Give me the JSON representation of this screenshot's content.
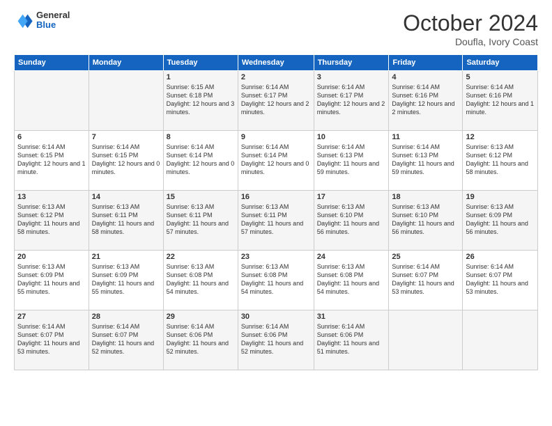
{
  "header": {
    "logo_general": "General",
    "logo_blue": "Blue",
    "month_title": "October 2024",
    "subtitle": "Doufla, Ivory Coast"
  },
  "weekdays": [
    "Sunday",
    "Monday",
    "Tuesday",
    "Wednesday",
    "Thursday",
    "Friday",
    "Saturday"
  ],
  "weeks": [
    [
      {
        "day": "",
        "info": ""
      },
      {
        "day": "",
        "info": ""
      },
      {
        "day": "1",
        "info": "Sunrise: 6:15 AM\nSunset: 6:18 PM\nDaylight: 12 hours and 3 minutes."
      },
      {
        "day": "2",
        "info": "Sunrise: 6:14 AM\nSunset: 6:17 PM\nDaylight: 12 hours and 2 minutes."
      },
      {
        "day": "3",
        "info": "Sunrise: 6:14 AM\nSunset: 6:17 PM\nDaylight: 12 hours and 2 minutes."
      },
      {
        "day": "4",
        "info": "Sunrise: 6:14 AM\nSunset: 6:16 PM\nDaylight: 12 hours and 2 minutes."
      },
      {
        "day": "5",
        "info": "Sunrise: 6:14 AM\nSunset: 6:16 PM\nDaylight: 12 hours and 1 minute."
      }
    ],
    [
      {
        "day": "6",
        "info": "Sunrise: 6:14 AM\nSunset: 6:15 PM\nDaylight: 12 hours and 1 minute."
      },
      {
        "day": "7",
        "info": "Sunrise: 6:14 AM\nSunset: 6:15 PM\nDaylight: 12 hours and 0 minutes."
      },
      {
        "day": "8",
        "info": "Sunrise: 6:14 AM\nSunset: 6:14 PM\nDaylight: 12 hours and 0 minutes."
      },
      {
        "day": "9",
        "info": "Sunrise: 6:14 AM\nSunset: 6:14 PM\nDaylight: 12 hours and 0 minutes."
      },
      {
        "day": "10",
        "info": "Sunrise: 6:14 AM\nSunset: 6:13 PM\nDaylight: 11 hours and 59 minutes."
      },
      {
        "day": "11",
        "info": "Sunrise: 6:14 AM\nSunset: 6:13 PM\nDaylight: 11 hours and 59 minutes."
      },
      {
        "day": "12",
        "info": "Sunrise: 6:13 AM\nSunset: 6:12 PM\nDaylight: 11 hours and 58 minutes."
      }
    ],
    [
      {
        "day": "13",
        "info": "Sunrise: 6:13 AM\nSunset: 6:12 PM\nDaylight: 11 hours and 58 minutes."
      },
      {
        "day": "14",
        "info": "Sunrise: 6:13 AM\nSunset: 6:11 PM\nDaylight: 11 hours and 58 minutes."
      },
      {
        "day": "15",
        "info": "Sunrise: 6:13 AM\nSunset: 6:11 PM\nDaylight: 11 hours and 57 minutes."
      },
      {
        "day": "16",
        "info": "Sunrise: 6:13 AM\nSunset: 6:11 PM\nDaylight: 11 hours and 57 minutes."
      },
      {
        "day": "17",
        "info": "Sunrise: 6:13 AM\nSunset: 6:10 PM\nDaylight: 11 hours and 56 minutes."
      },
      {
        "day": "18",
        "info": "Sunrise: 6:13 AM\nSunset: 6:10 PM\nDaylight: 11 hours and 56 minutes."
      },
      {
        "day": "19",
        "info": "Sunrise: 6:13 AM\nSunset: 6:09 PM\nDaylight: 11 hours and 56 minutes."
      }
    ],
    [
      {
        "day": "20",
        "info": "Sunrise: 6:13 AM\nSunset: 6:09 PM\nDaylight: 11 hours and 55 minutes."
      },
      {
        "day": "21",
        "info": "Sunrise: 6:13 AM\nSunset: 6:09 PM\nDaylight: 11 hours and 55 minutes."
      },
      {
        "day": "22",
        "info": "Sunrise: 6:13 AM\nSunset: 6:08 PM\nDaylight: 11 hours and 54 minutes."
      },
      {
        "day": "23",
        "info": "Sunrise: 6:13 AM\nSunset: 6:08 PM\nDaylight: 11 hours and 54 minutes."
      },
      {
        "day": "24",
        "info": "Sunrise: 6:13 AM\nSunset: 6:08 PM\nDaylight: 11 hours and 54 minutes."
      },
      {
        "day": "25",
        "info": "Sunrise: 6:14 AM\nSunset: 6:07 PM\nDaylight: 11 hours and 53 minutes."
      },
      {
        "day": "26",
        "info": "Sunrise: 6:14 AM\nSunset: 6:07 PM\nDaylight: 11 hours and 53 minutes."
      }
    ],
    [
      {
        "day": "27",
        "info": "Sunrise: 6:14 AM\nSunset: 6:07 PM\nDaylight: 11 hours and 53 minutes."
      },
      {
        "day": "28",
        "info": "Sunrise: 6:14 AM\nSunset: 6:07 PM\nDaylight: 11 hours and 52 minutes."
      },
      {
        "day": "29",
        "info": "Sunrise: 6:14 AM\nSunset: 6:06 PM\nDaylight: 11 hours and 52 minutes."
      },
      {
        "day": "30",
        "info": "Sunrise: 6:14 AM\nSunset: 6:06 PM\nDaylight: 11 hours and 52 minutes."
      },
      {
        "day": "31",
        "info": "Sunrise: 6:14 AM\nSunset: 6:06 PM\nDaylight: 11 hours and 51 minutes."
      },
      {
        "day": "",
        "info": ""
      },
      {
        "day": "",
        "info": ""
      }
    ]
  ]
}
